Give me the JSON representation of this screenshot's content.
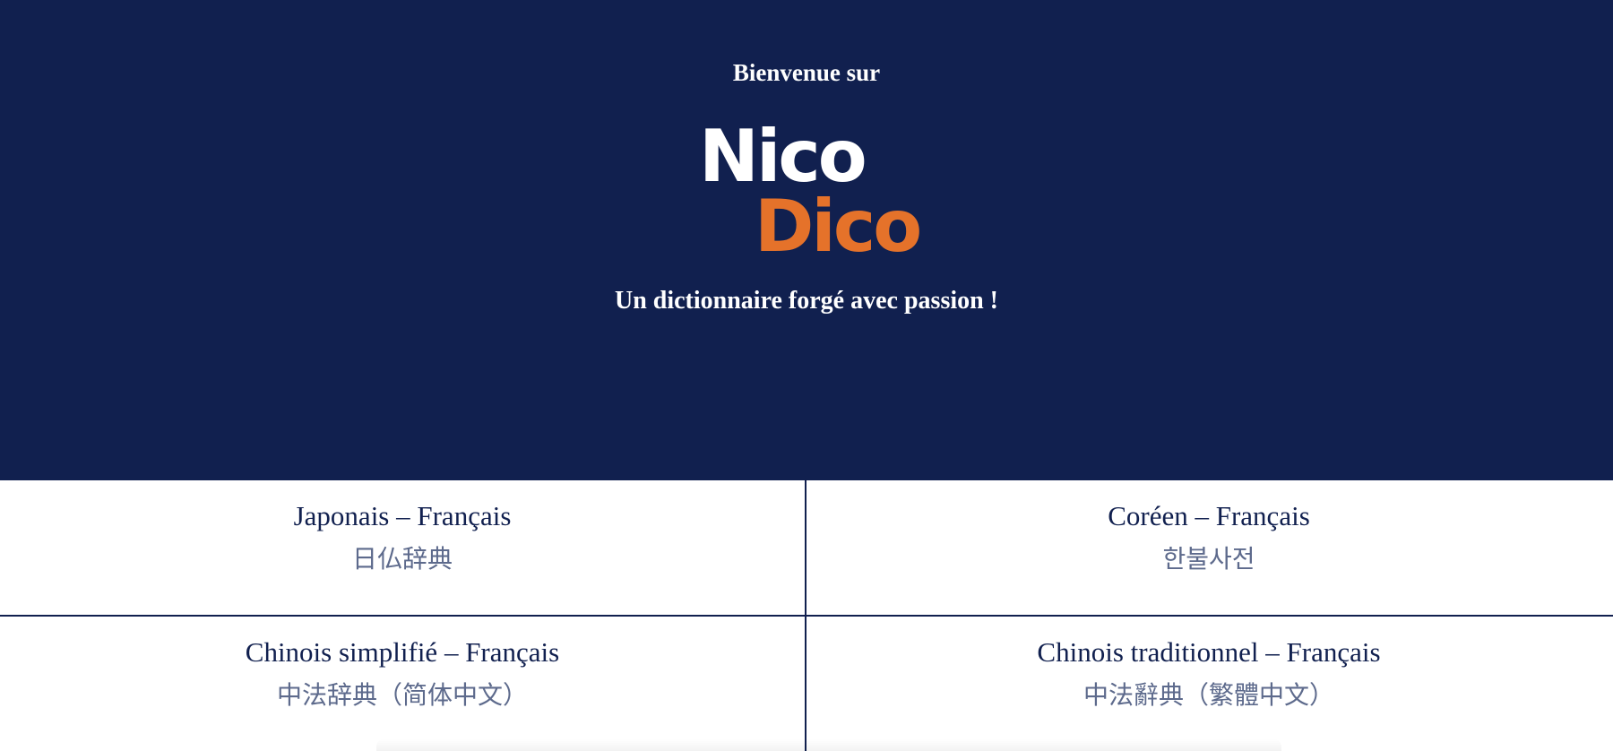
{
  "hero": {
    "welcome": "Bienvenue sur",
    "logo_line1": "Nico",
    "logo_line2": "Dico",
    "tagline": "Un dictionnaire forgé avec passion !"
  },
  "colors": {
    "background": "#11204f",
    "accent": "#e5722a",
    "text": "#ffffff",
    "link": "#11204f",
    "subtitle": "#5d6a8c"
  },
  "dictionaries": [
    {
      "title": "Japonais – Français",
      "subtitle": "日仏辞典"
    },
    {
      "title": "Coréen – Français",
      "subtitle": "한불사전"
    },
    {
      "title": "Chinois simplifié – Français",
      "subtitle": "中法辞典（简体中文）"
    },
    {
      "title": "Chinois traditionnel – Français",
      "subtitle": "中法辭典（繁體中文）"
    }
  ]
}
